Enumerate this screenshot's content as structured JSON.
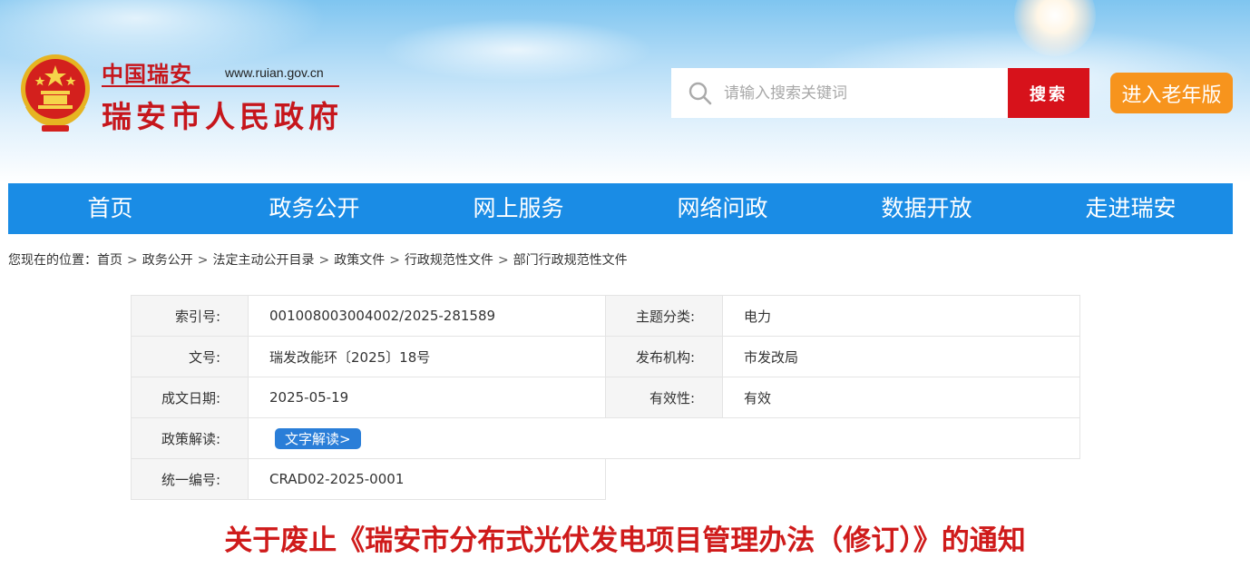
{
  "header": {
    "site_name": "中国瑞安",
    "domain": "www.ruian.gov.cn",
    "full_name": "瑞安市人民政府",
    "search_placeholder": "请输入搜索关键词",
    "search_button": "搜索",
    "elder_button": "进入老年版"
  },
  "nav": {
    "items": [
      "首页",
      "政务公开",
      "网上服务",
      "网络问政",
      "数据开放",
      "走进瑞安"
    ]
  },
  "breadcrumb": {
    "prefix": "您现在的位置：",
    "items": [
      "首页",
      "政务公开",
      "法定主动公开目录",
      "政策文件",
      "行政规范性文件",
      "部门行政规范性文件"
    ],
    "separator": ">"
  },
  "info": {
    "index_label": "索引号:",
    "index_value": "001008003004002/2025-281589",
    "topic_label": "主题分类:",
    "topic_value": "电力",
    "doc_no_label": "文号:",
    "doc_no_value": "瑞发改能环〔2025〕18号",
    "publisher_label": "发布机构:",
    "publisher_value": "市发改局",
    "date_label": "成文日期:",
    "date_value": "2025-05-19",
    "validity_label": "有效性:",
    "validity_value": "有效",
    "interpret_label": "政策解读:",
    "interpret_button": "文字解读>",
    "serial_label": "统一编号:",
    "serial_value": "CRAD02-2025-0001"
  },
  "document": {
    "title": "关于废止《瑞安市分布式光伏发电项目管理办法（修订）》的通知"
  },
  "colors": {
    "brand_red": "#c6161c",
    "nav_blue": "#1a8ce5",
    "search_red": "#d7121b",
    "elder_orange": "#f7941d",
    "read_blue": "#2a7ed8",
    "title_red": "#cf1b1b"
  }
}
